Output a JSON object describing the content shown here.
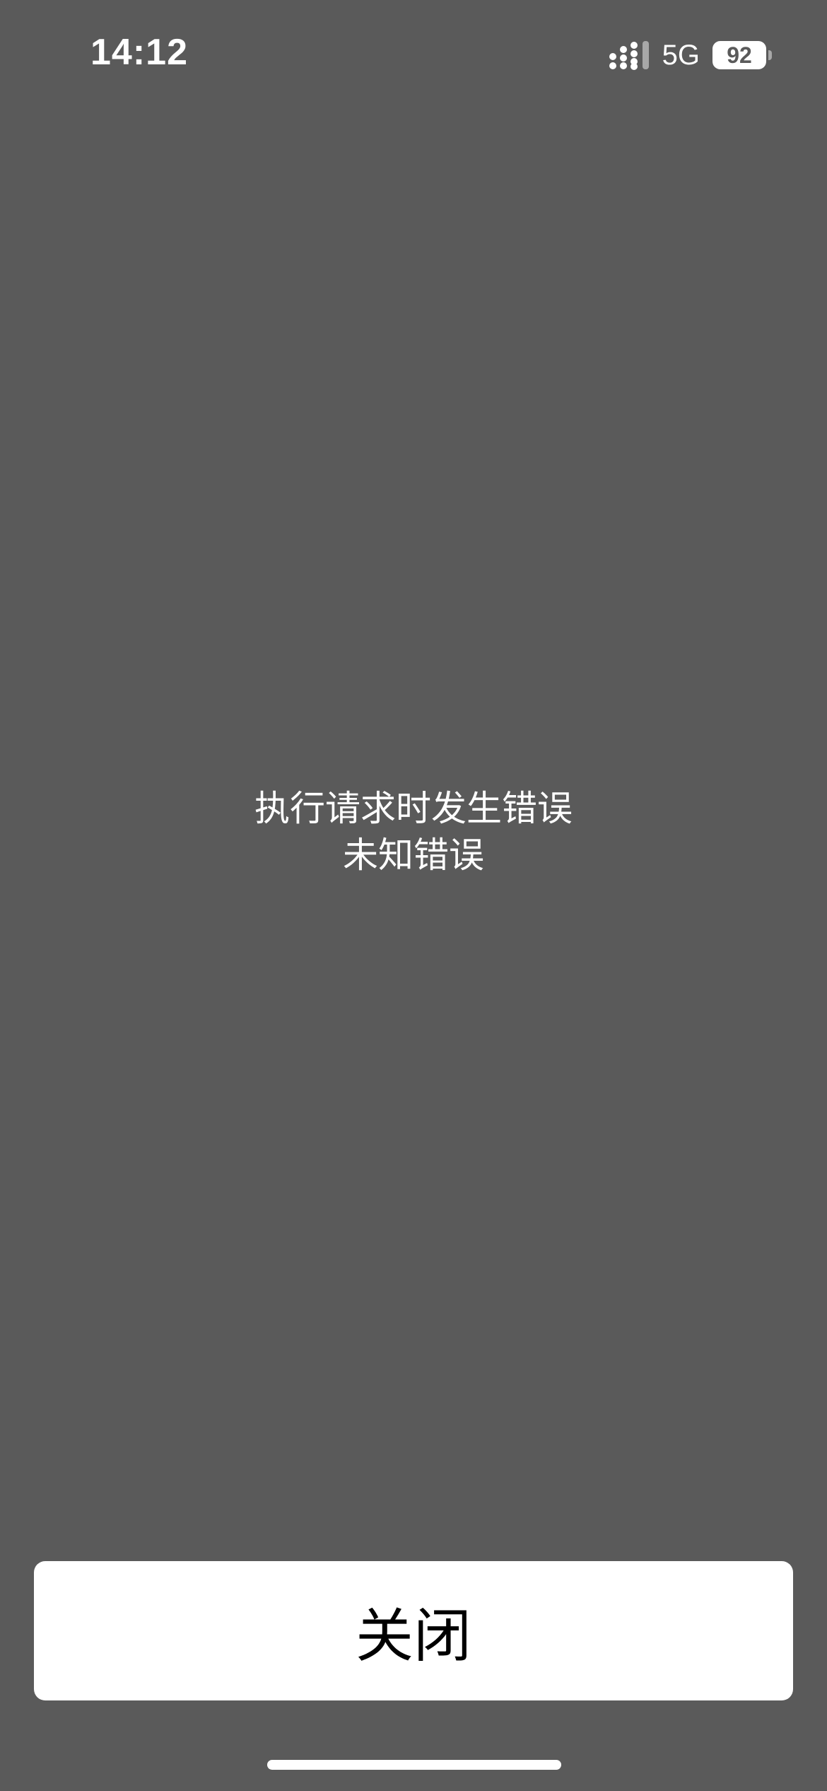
{
  "status_bar": {
    "time": "14:12",
    "signal_icon": "cellular-signal-icon",
    "network": "5G",
    "battery_level": "92",
    "battery_icon": "battery-icon"
  },
  "message": {
    "title": "执行请求时发生错误",
    "detail": "未知错误"
  },
  "close_button": {
    "label": "关闭"
  },
  "colors": {
    "background": "#5a5a5a",
    "button_background": "#ffffff",
    "text_light": "#ffffff",
    "text_dark": "#000000"
  }
}
